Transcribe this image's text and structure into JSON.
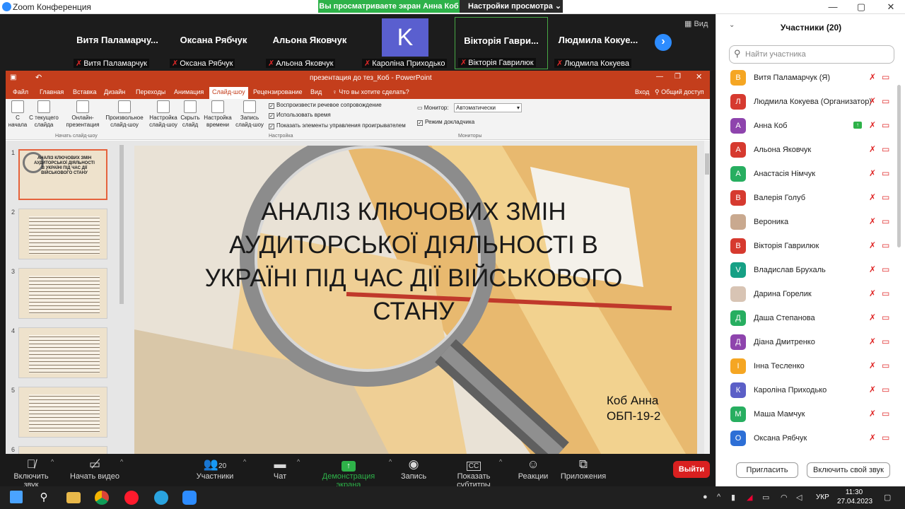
{
  "window": {
    "title": "Zoom Конференция",
    "min": "—",
    "max": "▢",
    "close": "✕"
  },
  "share_banner": {
    "text": "Вы просматриваете экран Анна Коб",
    "options": "Настройки просмотра"
  },
  "gallery": {
    "view_label": "Вид",
    "tiles": [
      {
        "name": "Витя  Паламарчу...",
        "label": "Витя Паламарчук"
      },
      {
        "name": "Оксана Рябчук",
        "label": "Оксана Рябчук"
      },
      {
        "name": "Альона Яковчук",
        "label": "Альона Яковчук"
      },
      {
        "avatar": "K",
        "label": "Кароліна Приходько"
      },
      {
        "name": "Вікторія  Гаври...",
        "label": "Вікторія Гаврилюк"
      },
      {
        "name": "Людмила  Кокуе...",
        "label": "Людмила Кокуева"
      }
    ]
  },
  "powerpoint": {
    "title": "презентация до тез_Коб - PowerPoint",
    "tabs": [
      "Файл",
      "Главная",
      "Вставка",
      "Дизайн",
      "Переходы",
      "Анимация",
      "Слайд-шоу",
      "Рецензирование",
      "Вид"
    ],
    "search": "Что вы хотите сделать?",
    "login": "Вход",
    "share": "Общий доступ",
    "buttons": [
      "С начала",
      "С текущего слайда",
      "Онлайн-презентация",
      "Произвольное слайд-шоу",
      "Настройка слайд-шоу",
      "Скрыть слайд",
      "Настройка времени",
      "Запись слайд-шоу"
    ],
    "checks": [
      "Воспроизвести речевое сопровождение",
      "Использовать время",
      "Показать элементы управления проигрывателем"
    ],
    "monitor_label": "Монитор:",
    "monitor_value": "Автоматически",
    "presenter": "Режим докладчика",
    "groups": [
      "Начать слайд-шоу",
      "Настройка",
      "Мониторы"
    ],
    "slide_numbers": [
      "1",
      "2",
      "3",
      "4",
      "5",
      "6"
    ],
    "thumb1_title": "АНАЛІЗ КЛЮЧОВИХ ЗМІН АУДИТОРСЬКОЇ ДІЯЛЬНОСТІ В УКРАЇНІ ПІД ЧАС ДІЇ ВІЙСЬКОВОГО СТАНУ",
    "slide": {
      "title": "АНАЛІЗ КЛЮЧОВИХ ЗМІН АУДИТОРСЬКОЇ ДІЯЛЬНОСТІ В УКРАЇНІ ПІД ЧАС ДІЇ ВІЙСЬКОВОГО СТАНУ",
      "author": "Коб Анна",
      "group": "ОБП-19-2"
    }
  },
  "participants": {
    "title": "Участники (20)",
    "search_placeholder": "Найти участника",
    "list": [
      {
        "initial": "В",
        "name": "Витя Паламарчук (Я)",
        "color": "#f5a623"
      },
      {
        "initial": "Л",
        "name": "Людмила Кокуева (Организатор)",
        "color": "#d63a2f"
      },
      {
        "initial": "А",
        "name": "Анна Коб",
        "color": "#8e44ad",
        "sharing": true
      },
      {
        "initial": "А",
        "name": "Альона Яковчук",
        "color": "#d63a2f"
      },
      {
        "initial": "А",
        "name": "Анастасія Німчук",
        "color": "#27ae60"
      },
      {
        "initial": "В",
        "name": "Валерія Голуб",
        "color": "#d63a2f"
      },
      {
        "initial": "",
        "name": "Вероника",
        "color": "#c9a98f"
      },
      {
        "initial": "В",
        "name": "Вікторія Гаврилюк",
        "color": "#d63a2f"
      },
      {
        "initial": "V",
        "name": "Владислав Брухаль",
        "color": "#16a085"
      },
      {
        "initial": "",
        "name": "Дарина Горелик",
        "color": "#d8c4b4"
      },
      {
        "initial": "Д",
        "name": "Даша Степанова",
        "color": "#27ae60"
      },
      {
        "initial": "Д",
        "name": "Діана Дмитренко",
        "color": "#8e44ad"
      },
      {
        "initial": "І",
        "name": "Інна Тесленко",
        "color": "#f5a623"
      },
      {
        "initial": "К",
        "name": "Кароліна Приходько",
        "color": "#5b5fc7"
      },
      {
        "initial": "М",
        "name": "Маша Мамчук",
        "color": "#27ae60"
      },
      {
        "initial": "О",
        "name": "Оксана Рябчук",
        "color": "#2d6fd6"
      }
    ],
    "invite": "Пригласить",
    "unmute": "Включить свой звук"
  },
  "toolbar": {
    "audio": "Включить звук",
    "video": "Начать видео",
    "participants": "Участники",
    "participants_count": "20",
    "chat": "Чат",
    "share": "Демонстрация экрана",
    "record": "Запись",
    "captions": "Показать субтитры",
    "reactions": "Реакции",
    "apps": "Приложения",
    "leave": "Выйти"
  },
  "taskbar": {
    "lang": "УКР",
    "time": "11:30",
    "date": "27.04.2023"
  }
}
